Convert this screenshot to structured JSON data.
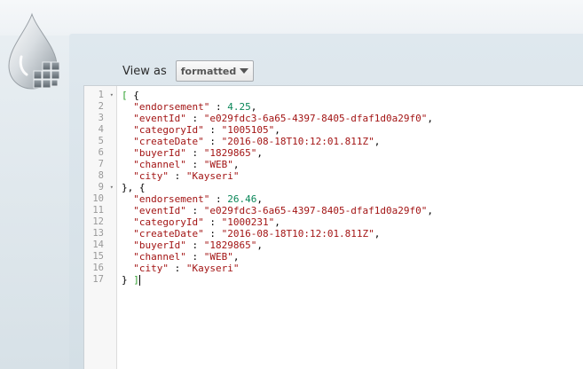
{
  "toolbar": {
    "view_as_label": "View as",
    "view_mode": "formatted"
  },
  "editor": {
    "line_numbers": [
      "1",
      "2",
      "3",
      "4",
      "5",
      "6",
      "7",
      "8",
      "9",
      "10",
      "11",
      "12",
      "13",
      "14",
      "15",
      "16",
      "17"
    ],
    "fold_lines": [
      1,
      9
    ],
    "lines": [
      "[ {",
      "  \"endorsement\" : 4.25,",
      "  \"eventId\" : \"e029fdc3-6a65-4397-8405-dfaf1d0a29f0\",",
      "  \"categoryId\" : \"1005105\",",
      "  \"createDate\" : \"2016-08-18T10:12:01.811Z\",",
      "  \"buyerId\" : \"1829865\",",
      "  \"channel\" : \"WEB\",",
      "  \"city\" : \"Kayseri\"",
      "}, {",
      "  \"endorsement\" : 26.46,",
      "  \"eventId\" : \"e029fdc3-6a65-4397-8405-dfaf1d0a29f0\",",
      "  \"categoryId\" : \"1000231\",",
      "  \"createDate\" : \"2016-08-18T10:12:01.811Z\",",
      "  \"buyerId\" : \"1829865\",",
      "  \"channel\" : \"WEB\",",
      "  \"city\" : \"Kayseri\"",
      "} ]"
    ]
  },
  "colors": {
    "key": "#a31515",
    "string": "#a31515",
    "number": "#098658",
    "bracket_match": "#2a9d2a"
  },
  "icons": {
    "logo": "water-drop-logo-icon"
  }
}
